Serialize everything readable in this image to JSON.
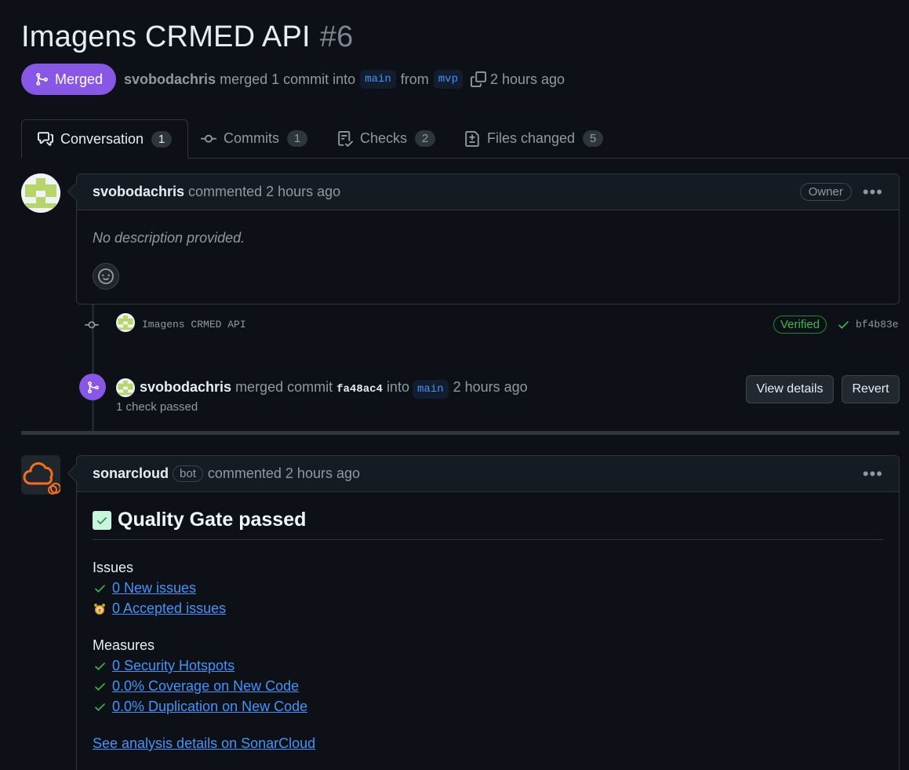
{
  "pr": {
    "title": "Imagens CRMED API",
    "number": "#6",
    "state": "Merged",
    "author": "svobodachris",
    "merged_text": "merged 1 commit into",
    "base_branch": "main",
    "from_text": "from",
    "head_branch": "mvp",
    "time": "2 hours ago"
  },
  "tabs": [
    {
      "label": "Conversation",
      "count": "1",
      "icon": "comment-discussion-icon"
    },
    {
      "label": "Commits",
      "count": "1",
      "icon": "git-commit-icon"
    },
    {
      "label": "Checks",
      "count": "2",
      "icon": "checklist-icon"
    },
    {
      "label": "Files changed",
      "count": "5",
      "icon": "file-diff-icon"
    }
  ],
  "comment1": {
    "author": "svobodachris",
    "action": "commented 2 hours ago",
    "role": "Owner",
    "body": "No description provided."
  },
  "commit": {
    "message": "Imagens CRMED API",
    "verified": "Verified",
    "sha": "bf4b83e"
  },
  "merge_event": {
    "author": "svobodachris",
    "text1": "merged commit",
    "sha": "fa48ac4",
    "text2": "into",
    "branch": "main",
    "time": "2 hours ago",
    "checks": "1 check passed",
    "view_details": "View details",
    "revert": "Revert"
  },
  "comment2": {
    "author": "sonarcloud",
    "bot": "bot",
    "action": "commented 2 hours ago",
    "heading": "Quality Gate passed",
    "issues_label": "Issues",
    "new_issues": "0 New issues",
    "accepted_issues": "0 Accepted issues",
    "measures_label": "Measures",
    "hotspots": "0 Security Hotspots",
    "coverage": "0.0% Coverage on New Code",
    "duplication": "0.0% Duplication on New Code",
    "details_link": "See analysis details on SonarCloud"
  },
  "colors": {
    "merged": "#8957e5",
    "link": "#4493f8",
    "success": "#3fb950",
    "sonar_orange": "#f36f21"
  }
}
